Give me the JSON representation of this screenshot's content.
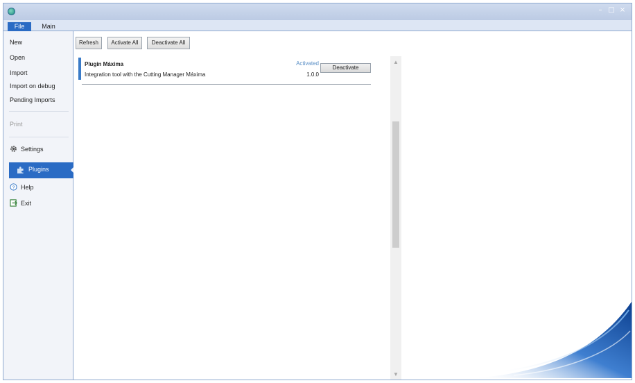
{
  "titlebar": {
    "buttons": [
      "–",
      "□",
      "×"
    ]
  },
  "ribbon": {
    "tabs": [
      "File",
      "Main"
    ],
    "selected_tab": "File"
  },
  "sidebar": {
    "items": [
      {
        "label": "New",
        "icon": "none",
        "enabled": true
      },
      {
        "label": "Open",
        "icon": "none",
        "enabled": true
      },
      {
        "label": "Import",
        "icon": "none",
        "enabled": true
      },
      {
        "label": "Import on debug",
        "icon": "none",
        "enabled": true
      },
      {
        "label": "Pending Imports",
        "icon": "none",
        "enabled": true
      },
      {
        "label": "Print",
        "icon": "none",
        "enabled": false
      },
      {
        "label": "Settings",
        "icon": "gear-icon",
        "enabled": true
      },
      {
        "label": "Plugins",
        "icon": "puzzle-icon",
        "enabled": true,
        "selected": true
      },
      {
        "label": "Help",
        "icon": "help-icon",
        "enabled": true
      },
      {
        "label": "Exit",
        "icon": "exit-icon",
        "enabled": true
      }
    ]
  },
  "toolbar": {
    "refresh_label": "Refresh",
    "activate_all_label": "Activate All",
    "deactivate_all_label": "Deactivate All"
  },
  "plugins": [
    {
      "name": "Plugin Máxima",
      "description": "Integration tool with the Cutting Manager Máxima",
      "status": "Activated",
      "version": "1.0.0",
      "action_label": "Deactivate"
    }
  ],
  "colors": {
    "accent": "#2a6bc4",
    "status": "#5a8fc6"
  }
}
